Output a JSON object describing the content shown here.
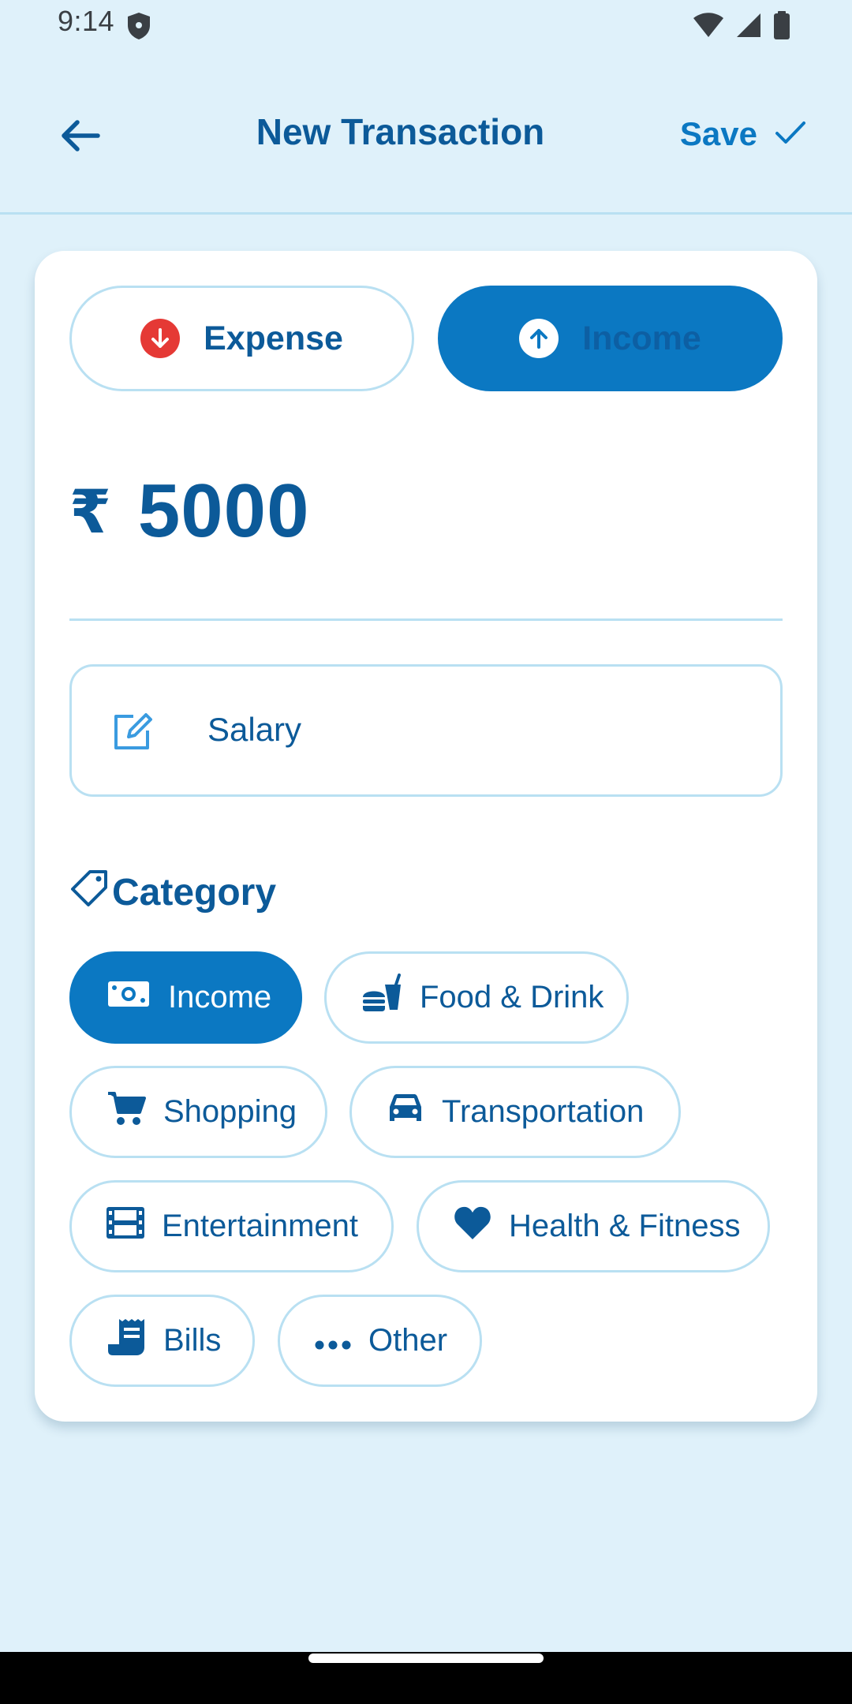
{
  "status": {
    "time": "9:14"
  },
  "header": {
    "title": "New Transaction",
    "save_label": "Save"
  },
  "type_toggle": {
    "expense_label": "Expense",
    "income_label": "Income",
    "selected": "Income"
  },
  "amount": {
    "currency": "₹",
    "value": "5000"
  },
  "note": {
    "value": "Salary"
  },
  "category": {
    "title": "Category",
    "selected": "Income",
    "items": [
      {
        "label": "Income",
        "icon": "money-icon"
      },
      {
        "label": "Food & Drink",
        "icon": "fastfood-icon"
      },
      {
        "label": "Shopping",
        "icon": "cart-icon"
      },
      {
        "label": "Transportation",
        "icon": "car-icon"
      },
      {
        "label": "Entertainment",
        "icon": "film-icon"
      },
      {
        "label": "Health & Fitness",
        "icon": "heart-icon"
      },
      {
        "label": "Bills",
        "icon": "receipt-icon"
      },
      {
        "label": "Other",
        "icon": "more-icon"
      }
    ]
  },
  "colors": {
    "background": "#dff1fa",
    "primary": "#0b78c2",
    "text": "#0c5a99",
    "border": "#b9e0f2",
    "expense_red": "#e53935"
  }
}
